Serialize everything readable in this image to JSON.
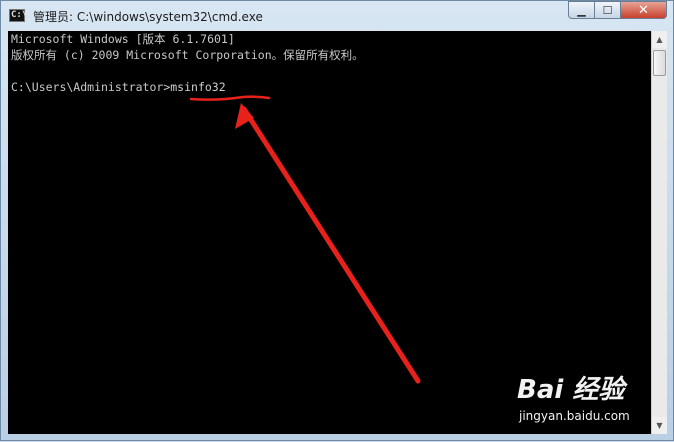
{
  "window": {
    "title": "管理员: C:\\windows\\system32\\cmd.exe",
    "icon": "cmd-icon",
    "icon_glyph": "C:\\",
    "controls": {
      "minimize": "minimize-icon",
      "maximize": "maximize-icon",
      "close": "close-icon"
    }
  },
  "console": {
    "lines": [
      "Microsoft Windows [版本 6.1.7601]",
      "版权所有 (c) 2009 Microsoft Corporation。保留所有权利。",
      "",
      "C:\\Users\\Administrator>"
    ],
    "command": "msinfo32",
    "text_color": "#c0c0c0",
    "background": "#000000"
  },
  "annotation": {
    "color": "#e8221b",
    "type": "red-arrow-and-underline"
  },
  "watermark": {
    "logo": "Bai 经验",
    "url": "jingyan.baidu.com"
  }
}
